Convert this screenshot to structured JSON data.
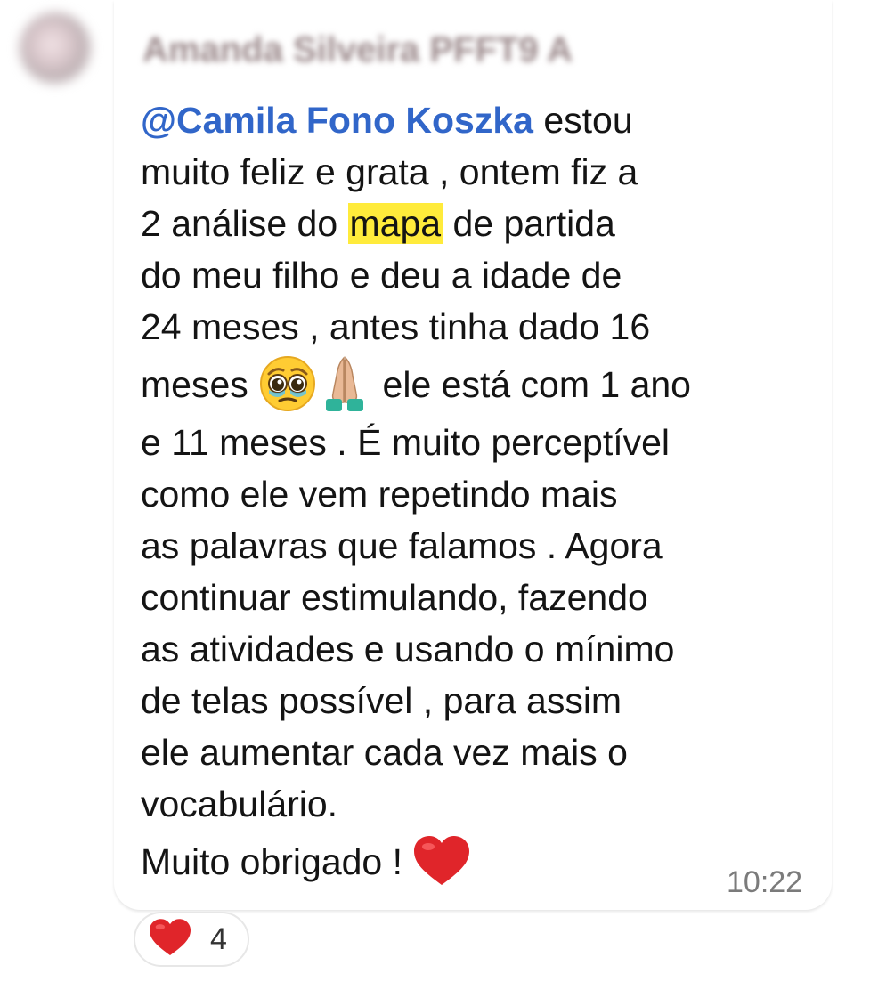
{
  "message": {
    "sender_name": "Amanda Silveira PFFT9 A",
    "mention": "@Camila Fono Koszka",
    "line_1_rest": " estou",
    "line_2": "muito feliz e grata , ontem fiz a",
    "line_3_before": "2 análise do ",
    "line_3_highlight": "mapa",
    "line_3_after": " de partida",
    "line_4": "do meu filho e deu a idade de",
    "line_5": "24 meses  , antes tinha dado 16",
    "line_6_before": "meses ",
    "line_6_after": "  ele está com 1 ano",
    "line_7": "e 11 meses . É muito perceptível",
    "line_8": "como ele vem repetindo mais",
    "line_9": "as palavras que falamos . Agora",
    "line_10": "continuar estimulando,  fazendo",
    "line_11": "as atividades e usando o mínimo",
    "line_12": "de telas possível , para assim",
    "line_13": "ele aumentar cada vez mais o",
    "line_14": "vocabulário.",
    "line_15": "Muito obrigado ! ",
    "timestamp": "10:22",
    "emojis": [
      "pleading-face-emoji",
      "folded-hands-emoji",
      "red-heart-emoji"
    ]
  },
  "reaction": {
    "icon": "red-heart-emoji",
    "count": "4"
  },
  "colors": {
    "mention": "#3166c9",
    "highlight": "#ffeb3b",
    "timestamp": "#7b7b7b",
    "heart": "#e0252a"
  }
}
